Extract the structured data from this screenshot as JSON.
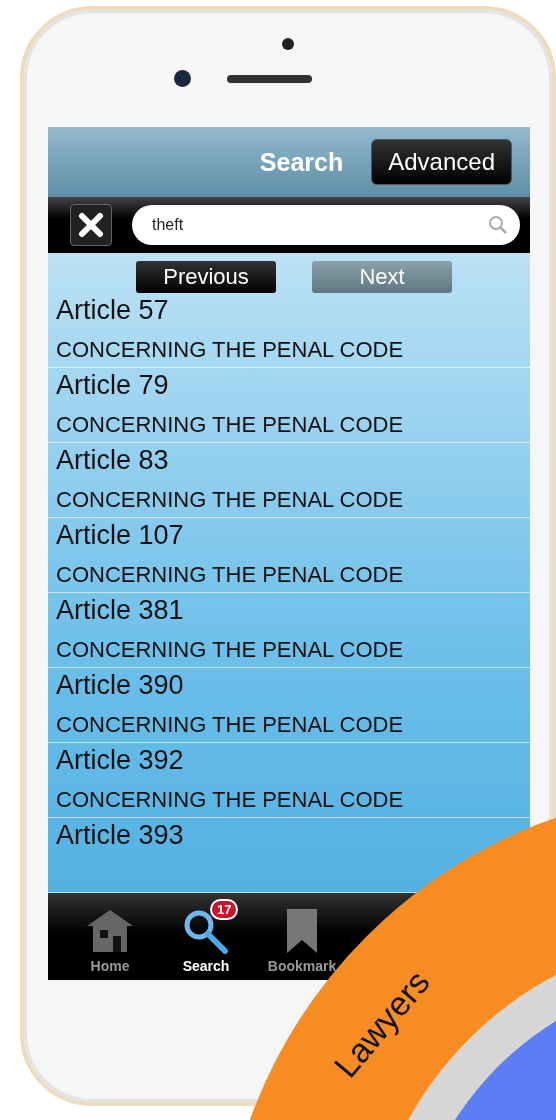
{
  "header": {
    "title": "Search",
    "advanced_button": "Advanced"
  },
  "search": {
    "value": "theft"
  },
  "pager": {
    "previous": "Previous",
    "next": "Next",
    "previous_enabled": true,
    "next_enabled": false
  },
  "results": [
    {
      "title": "Article 57",
      "subtitle": "CONCERNING THE PENAL CODE"
    },
    {
      "title": "Article 79",
      "subtitle": "CONCERNING THE PENAL CODE"
    },
    {
      "title": "Article 83",
      "subtitle": "CONCERNING THE PENAL CODE"
    },
    {
      "title": "Article 107",
      "subtitle": "CONCERNING THE PENAL CODE"
    },
    {
      "title": "Article 381",
      "subtitle": "CONCERNING THE PENAL CODE"
    },
    {
      "title": "Article 390",
      "subtitle": "CONCERNING THE PENAL CODE"
    },
    {
      "title": "Article 392",
      "subtitle": "CONCERNING THE PENAL CODE"
    },
    {
      "title": "Article 393"
    }
  ],
  "tab_bar": [
    {
      "label": "Home",
      "kind": "home",
      "selected": false
    },
    {
      "label": "Search",
      "kind": "search",
      "selected": true,
      "badge": "17"
    },
    {
      "label": "Bookmark",
      "kind": "bookmark",
      "selected": false
    }
  ],
  "overlay": {
    "label": "Lawyers"
  }
}
